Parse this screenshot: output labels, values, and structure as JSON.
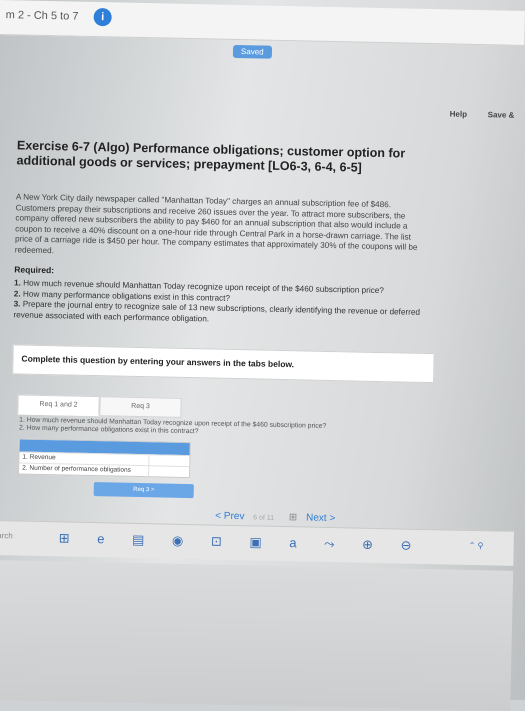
{
  "header": {
    "crumb": "m 2 - Ch 5 to 7",
    "badge": "i",
    "saved": "Saved",
    "help": "Help",
    "save_exit": "Save &"
  },
  "exercise": {
    "title": "Exercise 6-7 (Algo) Performance obligations; customer option for additional goods or services; prepayment [LO6-3, 6-4, 6-5]",
    "body": "A New York City daily newspaper called \"Manhattan Today\" charges an annual subscription fee of $486. Customers prepay their subscriptions and receive 260 issues over the year. To attract more subscribers, the company offered new subscribers the ability to pay $460 for an annual subscription that also would include a coupon to receive a 40% discount on a one-hour ride through Central Park in a horse-drawn carriage. The list price of a carriage ride is $450 per hour. The company estimates that approximately 30% of the coupons will be redeemed.",
    "required_label": "Required:",
    "requirements": [
      {
        "num": "1.",
        "text": "How much revenue should Manhattan Today recognize upon receipt of the $460 subscription price?"
      },
      {
        "num": "2.",
        "text": "How many performance obligations exist in this contract?"
      },
      {
        "num": "3.",
        "text": "Prepare the journal entry to recognize sale of 13 new subscriptions, clearly identifying the revenue or deferred revenue associated with each performance obligation."
      }
    ],
    "instruction": "Complete this question by entering your answers in the tabs below."
  },
  "tabs": {
    "t1": "Req 1 and 2",
    "t2": "Req 3"
  },
  "question_text": {
    "q1": "1. How much revenue should Manhattan Today recognize upon receipt of the $460 subscription price?",
    "q2": "2. How many performance obligations exist in this contract?"
  },
  "answer_table": {
    "row1": "1. Revenue",
    "row2": "2. Number of performance obligations"
  },
  "buttons": {
    "req3": "Req 3 >"
  },
  "pagination": {
    "prev": "< Prev",
    "page": "6 of 11",
    "next": "Next >",
    "grid": "⊞"
  },
  "taskbar": {
    "search": "earch",
    "icons": "⊞ e ▤ ◉ ⊡ ▣ a ⤳ ⊕ ⊖",
    "tray": "⌃ ⚲"
  },
  "colors": {
    "accent": "#2f7ed8",
    "tab_blue": "#5a9be0"
  }
}
